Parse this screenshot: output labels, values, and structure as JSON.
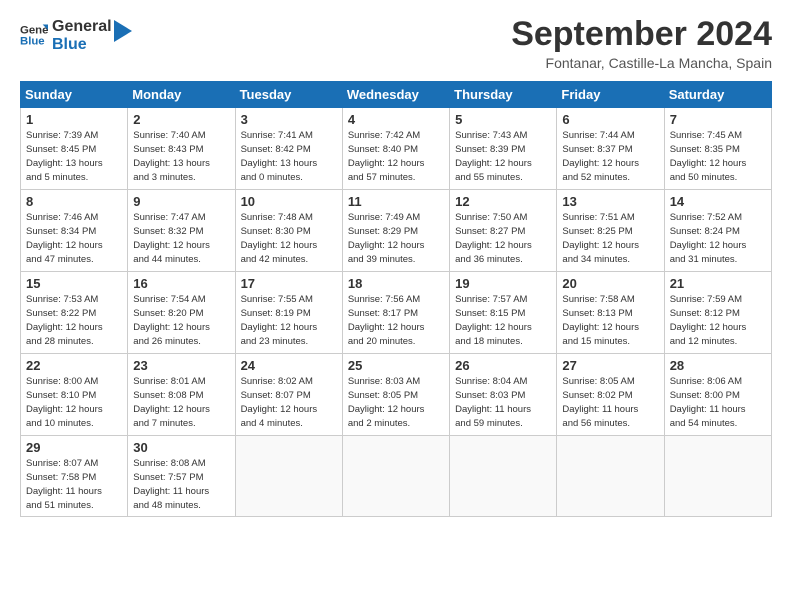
{
  "logo": {
    "line1": "General",
    "line2": "Blue"
  },
  "title": "September 2024",
  "location": "Fontanar, Castille-La Mancha, Spain",
  "weekdays": [
    "Sunday",
    "Monday",
    "Tuesday",
    "Wednesday",
    "Thursday",
    "Friday",
    "Saturday"
  ],
  "weeks": [
    [
      {
        "day": "1",
        "info": "Sunrise: 7:39 AM\nSunset: 8:45 PM\nDaylight: 13 hours\nand 5 minutes."
      },
      {
        "day": "2",
        "info": "Sunrise: 7:40 AM\nSunset: 8:43 PM\nDaylight: 13 hours\nand 3 minutes."
      },
      {
        "day": "3",
        "info": "Sunrise: 7:41 AM\nSunset: 8:42 PM\nDaylight: 13 hours\nand 0 minutes."
      },
      {
        "day": "4",
        "info": "Sunrise: 7:42 AM\nSunset: 8:40 PM\nDaylight: 12 hours\nand 57 minutes."
      },
      {
        "day": "5",
        "info": "Sunrise: 7:43 AM\nSunset: 8:39 PM\nDaylight: 12 hours\nand 55 minutes."
      },
      {
        "day": "6",
        "info": "Sunrise: 7:44 AM\nSunset: 8:37 PM\nDaylight: 12 hours\nand 52 minutes."
      },
      {
        "day": "7",
        "info": "Sunrise: 7:45 AM\nSunset: 8:35 PM\nDaylight: 12 hours\nand 50 minutes."
      }
    ],
    [
      {
        "day": "8",
        "info": "Sunrise: 7:46 AM\nSunset: 8:34 PM\nDaylight: 12 hours\nand 47 minutes."
      },
      {
        "day": "9",
        "info": "Sunrise: 7:47 AM\nSunset: 8:32 PM\nDaylight: 12 hours\nand 44 minutes."
      },
      {
        "day": "10",
        "info": "Sunrise: 7:48 AM\nSunset: 8:30 PM\nDaylight: 12 hours\nand 42 minutes."
      },
      {
        "day": "11",
        "info": "Sunrise: 7:49 AM\nSunset: 8:29 PM\nDaylight: 12 hours\nand 39 minutes."
      },
      {
        "day": "12",
        "info": "Sunrise: 7:50 AM\nSunset: 8:27 PM\nDaylight: 12 hours\nand 36 minutes."
      },
      {
        "day": "13",
        "info": "Sunrise: 7:51 AM\nSunset: 8:25 PM\nDaylight: 12 hours\nand 34 minutes."
      },
      {
        "day": "14",
        "info": "Sunrise: 7:52 AM\nSunset: 8:24 PM\nDaylight: 12 hours\nand 31 minutes."
      }
    ],
    [
      {
        "day": "15",
        "info": "Sunrise: 7:53 AM\nSunset: 8:22 PM\nDaylight: 12 hours\nand 28 minutes."
      },
      {
        "day": "16",
        "info": "Sunrise: 7:54 AM\nSunset: 8:20 PM\nDaylight: 12 hours\nand 26 minutes."
      },
      {
        "day": "17",
        "info": "Sunrise: 7:55 AM\nSunset: 8:19 PM\nDaylight: 12 hours\nand 23 minutes."
      },
      {
        "day": "18",
        "info": "Sunrise: 7:56 AM\nSunset: 8:17 PM\nDaylight: 12 hours\nand 20 minutes."
      },
      {
        "day": "19",
        "info": "Sunrise: 7:57 AM\nSunset: 8:15 PM\nDaylight: 12 hours\nand 18 minutes."
      },
      {
        "day": "20",
        "info": "Sunrise: 7:58 AM\nSunset: 8:13 PM\nDaylight: 12 hours\nand 15 minutes."
      },
      {
        "day": "21",
        "info": "Sunrise: 7:59 AM\nSunset: 8:12 PM\nDaylight: 12 hours\nand 12 minutes."
      }
    ],
    [
      {
        "day": "22",
        "info": "Sunrise: 8:00 AM\nSunset: 8:10 PM\nDaylight: 12 hours\nand 10 minutes."
      },
      {
        "day": "23",
        "info": "Sunrise: 8:01 AM\nSunset: 8:08 PM\nDaylight: 12 hours\nand 7 minutes."
      },
      {
        "day": "24",
        "info": "Sunrise: 8:02 AM\nSunset: 8:07 PM\nDaylight: 12 hours\nand 4 minutes."
      },
      {
        "day": "25",
        "info": "Sunrise: 8:03 AM\nSunset: 8:05 PM\nDaylight: 12 hours\nand 2 minutes."
      },
      {
        "day": "26",
        "info": "Sunrise: 8:04 AM\nSunset: 8:03 PM\nDaylight: 11 hours\nand 59 minutes."
      },
      {
        "day": "27",
        "info": "Sunrise: 8:05 AM\nSunset: 8:02 PM\nDaylight: 11 hours\nand 56 minutes."
      },
      {
        "day": "28",
        "info": "Sunrise: 8:06 AM\nSunset: 8:00 PM\nDaylight: 11 hours\nand 54 minutes."
      }
    ],
    [
      {
        "day": "29",
        "info": "Sunrise: 8:07 AM\nSunset: 7:58 PM\nDaylight: 11 hours\nand 51 minutes."
      },
      {
        "day": "30",
        "info": "Sunrise: 8:08 AM\nSunset: 7:57 PM\nDaylight: 11 hours\nand 48 minutes."
      },
      {
        "day": "",
        "info": ""
      },
      {
        "day": "",
        "info": ""
      },
      {
        "day": "",
        "info": ""
      },
      {
        "day": "",
        "info": ""
      },
      {
        "day": "",
        "info": ""
      }
    ]
  ]
}
